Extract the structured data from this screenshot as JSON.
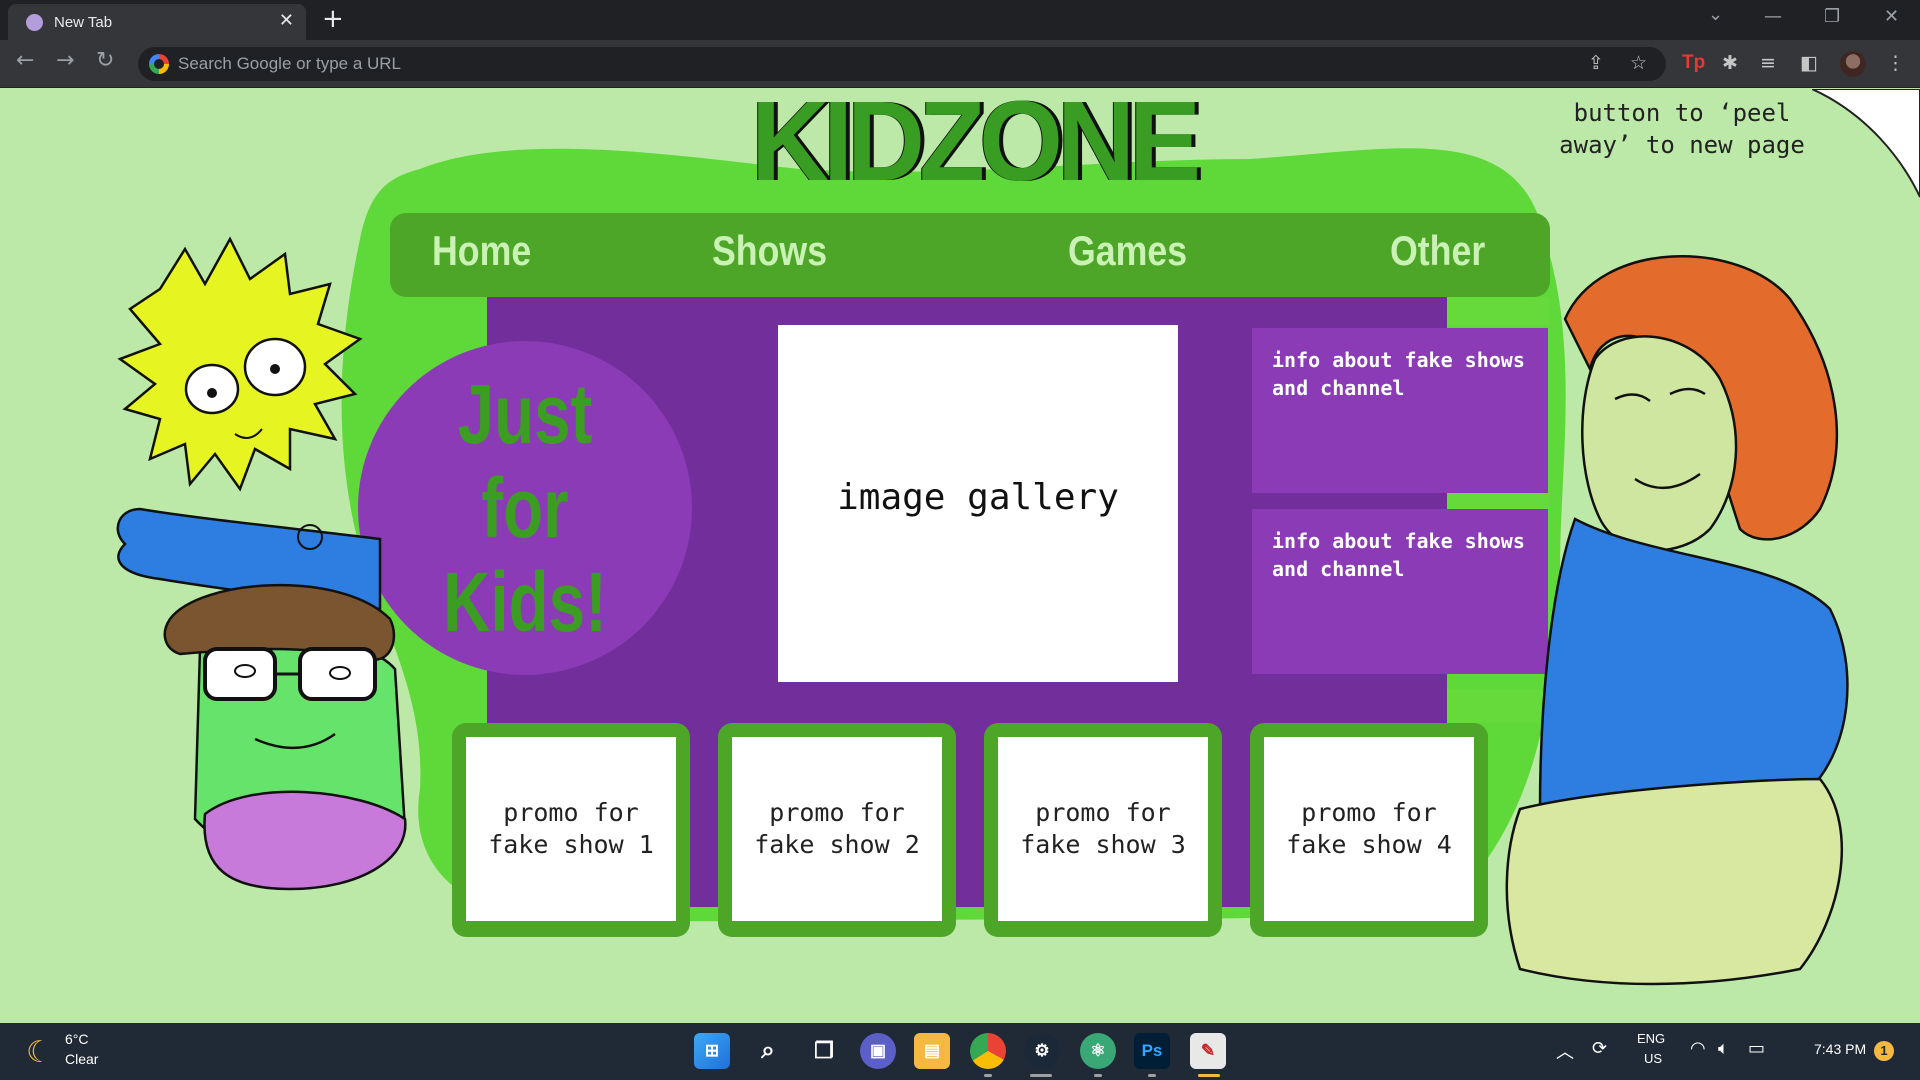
{
  "browser": {
    "tab_title": "New Tab",
    "tab_close": "✕",
    "new_tab": "+",
    "omnibox_placeholder": "Search Google or type a URL",
    "window_controls": {
      "minimize": "—",
      "restore": "❐",
      "close": "✕",
      "dropdown": "⌄"
    }
  },
  "page": {
    "logo": "KIDZONE",
    "nav": [
      "Home",
      "Shows",
      "Games",
      "Other"
    ],
    "circle_lines": [
      "Just",
      "for",
      "Kids!"
    ],
    "gallery": "image gallery",
    "info_boxes": [
      "info about fake shows and channel",
      "info about fake shows and channel"
    ],
    "promos": [
      "promo for fake show 1",
      "promo for fake show 2",
      "promo for fake show 3",
      "promo for fake show 4"
    ],
    "peel_note": "button to ‘peel away’ to new page",
    "colors": {
      "background": "#bce9a8",
      "blob": "#5fd83a",
      "nav_green": "#4ea629",
      "purple_dark": "#722e9a",
      "purple_light": "#8a3bb5",
      "logo_green": "#3a9d23"
    }
  },
  "taskbar": {
    "temperature": "6°C",
    "condition": "Clear",
    "lang_line1": "ENG",
    "lang_line2": "US",
    "time": "7:43 PM",
    "notifications": "1",
    "apps": [
      "start",
      "search",
      "task-view",
      "chat",
      "file-explorer",
      "chrome",
      "steam",
      "atom",
      "photoshop",
      "paint"
    ]
  }
}
